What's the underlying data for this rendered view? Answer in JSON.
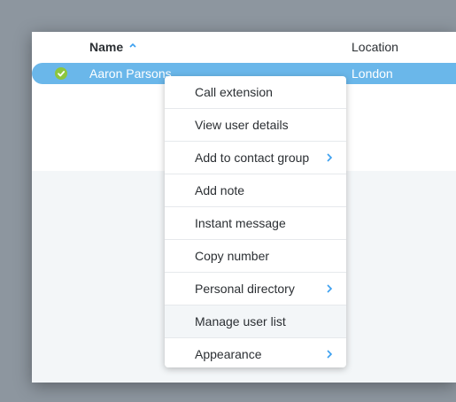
{
  "table": {
    "columns": {
      "name": "Name",
      "location": "Location"
    },
    "rows": [
      {
        "name": "Aaron Parsons",
        "location": "London",
        "status": "available"
      }
    ]
  },
  "context_menu": {
    "items": [
      {
        "label": "Call extension",
        "submenu": false
      },
      {
        "label": "View user details",
        "submenu": false
      },
      {
        "label": "Add to contact group",
        "submenu": true
      },
      {
        "label": "Add note",
        "submenu": false
      },
      {
        "label": "Instant message",
        "submenu": false
      },
      {
        "label": "Copy number",
        "submenu": false
      },
      {
        "label": "Personal directory",
        "submenu": true
      },
      {
        "label": "Manage user list",
        "submenu": false,
        "highlighted": true
      },
      {
        "label": "Appearance",
        "submenu": true
      }
    ]
  },
  "colors": {
    "selection": "#6ab7ea",
    "status_available": "#8cc63f",
    "accent": "#3a9ff0"
  },
  "icons": {
    "sort": "sort-ascending-icon",
    "status": "checkmark-icon",
    "submenu": "chevron-right-icon"
  }
}
